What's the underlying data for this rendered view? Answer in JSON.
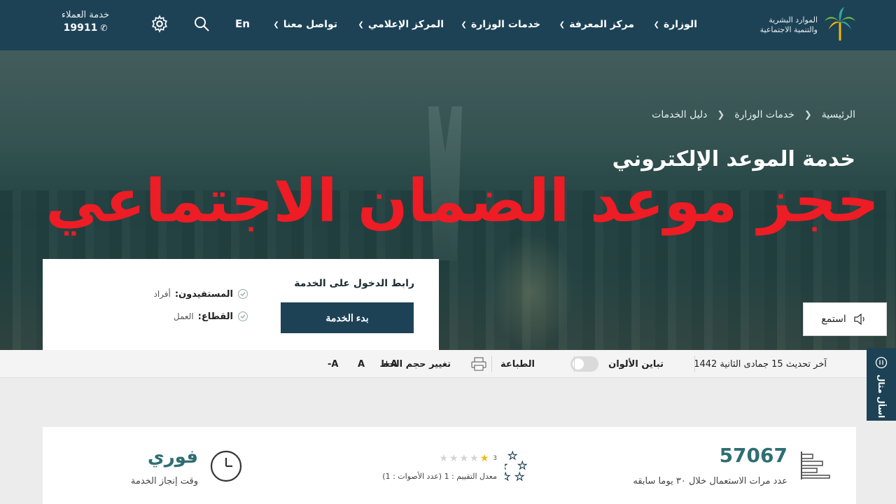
{
  "header": {
    "logo_text_line1": "الموارد البشرية",
    "logo_text_line2": "والتنمية الاجتماعية",
    "nav": [
      {
        "label": "الوزارة"
      },
      {
        "label": "مركز المعرفة"
      },
      {
        "label": "خدمات الوزارة"
      },
      {
        "label": "المركز الإعلامي"
      },
      {
        "label": "تواصل معنا"
      }
    ],
    "lang": "En",
    "customer_service_label": "خدمة العملاء",
    "customer_service_number": "19911"
  },
  "breadcrumb": [
    "الرئيسية",
    "خدمات الوزارة",
    "دليل الخدمات"
  ],
  "page_title": "خدمة الموعد الإلكتروني",
  "overlay_title": "حجز موعد الضمان الاجتماعي",
  "service_card": {
    "heading": "رابط الدخول على الخدمة",
    "button": "بدء الخدمة",
    "beneficiaries_label": "المستفيدون:",
    "beneficiaries_value": "أفراد",
    "sector_label": "القطاع:",
    "sector_value": "العمل"
  },
  "listen_label": "استمع",
  "toolbar": {
    "last_update": "آخر تحديث 15 جمادى الثانية 1442",
    "contrast_label": "تباين الألوان",
    "print_label": "الطباعة",
    "font_size_label": "تغيير حجم الخط",
    "font_plus": "A+",
    "font_normal": "A",
    "font_minus": "A-"
  },
  "side_tab_label": "اسأل مثال",
  "stats": {
    "usage_count": "57067",
    "usage_label": "عدد مرات الاستعمال خلال ٣٠ يوما سابقه",
    "rating_badge": "3",
    "rating_label": "معدل التقييم : 1 (عدد الأصوات : 1)",
    "rating_value": 1,
    "rating_max": 5,
    "time_value": "فوري",
    "time_label": "وقت إنجاز الخدمة"
  },
  "colors": {
    "header_bg": "#1d4256",
    "overlay_red": "#ee1c25",
    "accent_teal": "#2f6e73",
    "star_gold": "#f2b705"
  }
}
